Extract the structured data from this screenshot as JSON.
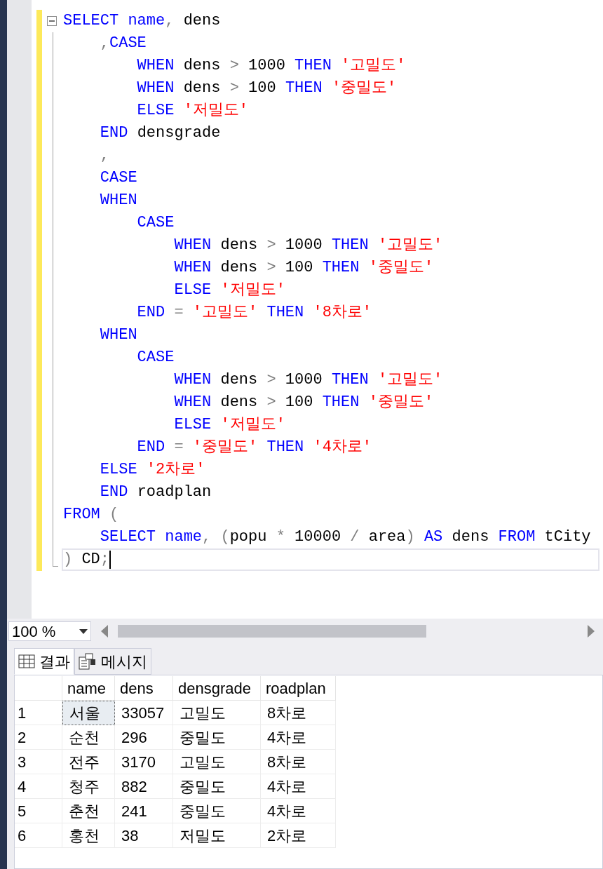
{
  "editor": {
    "lines": [
      {
        "fold_box": true,
        "changed": true,
        "current": false,
        "tokens": [
          {
            "kind": "kw",
            "text": "SELECT "
          },
          {
            "kind": "kw",
            "text": "name"
          },
          {
            "kind": "op",
            "text": ", "
          },
          {
            "kind": "txt",
            "text": "dens"
          }
        ]
      },
      {
        "changed": true,
        "current": false,
        "tokens": [
          {
            "kind": "op",
            "text": "    ,"
          },
          {
            "kind": "kw",
            "text": "CASE"
          }
        ]
      },
      {
        "changed": true,
        "current": false,
        "tokens": [
          {
            "kind": "kw",
            "text": "        WHEN "
          },
          {
            "kind": "txt",
            "text": "dens "
          },
          {
            "kind": "op",
            "text": "> "
          },
          {
            "kind": "txt",
            "text": "1000 "
          },
          {
            "kind": "kw",
            "text": "THEN "
          },
          {
            "kind": "str",
            "text": "'고밀도'"
          }
        ]
      },
      {
        "changed": true,
        "current": false,
        "tokens": [
          {
            "kind": "kw",
            "text": "        WHEN "
          },
          {
            "kind": "txt",
            "text": "dens "
          },
          {
            "kind": "op",
            "text": "> "
          },
          {
            "kind": "txt",
            "text": "100 "
          },
          {
            "kind": "kw",
            "text": "THEN "
          },
          {
            "kind": "str",
            "text": "'중밀도'"
          }
        ]
      },
      {
        "changed": true,
        "current": false,
        "tokens": [
          {
            "kind": "kw",
            "text": "        ELSE "
          },
          {
            "kind": "str",
            "text": "'저밀도'"
          }
        ]
      },
      {
        "changed": true,
        "current": false,
        "tokens": [
          {
            "kind": "kw",
            "text": "    END "
          },
          {
            "kind": "txt",
            "text": "densgrade"
          }
        ]
      },
      {
        "changed": true,
        "current": false,
        "tokens": [
          {
            "kind": "op",
            "text": "    ,"
          }
        ]
      },
      {
        "changed": true,
        "current": false,
        "tokens": [
          {
            "kind": "kw",
            "text": "    CASE"
          }
        ]
      },
      {
        "changed": true,
        "current": false,
        "tokens": [
          {
            "kind": "kw",
            "text": "    WHEN"
          }
        ]
      },
      {
        "changed": true,
        "current": false,
        "tokens": [
          {
            "kind": "kw",
            "text": "        CASE"
          }
        ]
      },
      {
        "changed": true,
        "current": false,
        "tokens": [
          {
            "kind": "kw",
            "text": "            WHEN "
          },
          {
            "kind": "txt",
            "text": "dens "
          },
          {
            "kind": "op",
            "text": "> "
          },
          {
            "kind": "txt",
            "text": "1000 "
          },
          {
            "kind": "kw",
            "text": "THEN "
          },
          {
            "kind": "str",
            "text": "'고밀도'"
          }
        ]
      },
      {
        "changed": true,
        "current": false,
        "tokens": [
          {
            "kind": "kw",
            "text": "            WHEN "
          },
          {
            "kind": "txt",
            "text": "dens "
          },
          {
            "kind": "op",
            "text": "> "
          },
          {
            "kind": "txt",
            "text": "100 "
          },
          {
            "kind": "kw",
            "text": "THEN "
          },
          {
            "kind": "str",
            "text": "'중밀도'"
          }
        ]
      },
      {
        "changed": true,
        "current": false,
        "tokens": [
          {
            "kind": "kw",
            "text": "            ELSE "
          },
          {
            "kind": "str",
            "text": "'저밀도'"
          }
        ]
      },
      {
        "changed": true,
        "current": false,
        "tokens": [
          {
            "kind": "kw",
            "text": "        END "
          },
          {
            "kind": "op",
            "text": "= "
          },
          {
            "kind": "str",
            "text": "'고밀도' "
          },
          {
            "kind": "kw",
            "text": "THEN "
          },
          {
            "kind": "str",
            "text": "'8차로'"
          }
        ]
      },
      {
        "changed": true,
        "current": false,
        "tokens": [
          {
            "kind": "kw",
            "text": "    WHEN"
          }
        ]
      },
      {
        "changed": true,
        "current": false,
        "tokens": [
          {
            "kind": "kw",
            "text": "        CASE"
          }
        ]
      },
      {
        "changed": true,
        "current": false,
        "tokens": [
          {
            "kind": "kw",
            "text": "            WHEN "
          },
          {
            "kind": "txt",
            "text": "dens "
          },
          {
            "kind": "op",
            "text": "> "
          },
          {
            "kind": "txt",
            "text": "1000 "
          },
          {
            "kind": "kw",
            "text": "THEN "
          },
          {
            "kind": "str",
            "text": "'고밀도'"
          }
        ]
      },
      {
        "changed": true,
        "current": false,
        "tokens": [
          {
            "kind": "kw",
            "text": "            WHEN "
          },
          {
            "kind": "txt",
            "text": "dens "
          },
          {
            "kind": "op",
            "text": "> "
          },
          {
            "kind": "txt",
            "text": "100 "
          },
          {
            "kind": "kw",
            "text": "THEN "
          },
          {
            "kind": "str",
            "text": "'중밀도'"
          }
        ]
      },
      {
        "changed": true,
        "current": false,
        "tokens": [
          {
            "kind": "kw",
            "text": "            ELSE "
          },
          {
            "kind": "str",
            "text": "'저밀도'"
          }
        ]
      },
      {
        "changed": true,
        "current": false,
        "tokens": [
          {
            "kind": "kw",
            "text": "        END "
          },
          {
            "kind": "op",
            "text": "= "
          },
          {
            "kind": "str",
            "text": "'중밀도' "
          },
          {
            "kind": "kw",
            "text": "THEN "
          },
          {
            "kind": "str",
            "text": "'4차로'"
          }
        ]
      },
      {
        "changed": true,
        "current": false,
        "tokens": [
          {
            "kind": "kw",
            "text": "    ELSE "
          },
          {
            "kind": "str",
            "text": "'2차로'"
          }
        ]
      },
      {
        "changed": true,
        "current": false,
        "tokens": [
          {
            "kind": "kw",
            "text": "    END "
          },
          {
            "kind": "txt",
            "text": "roadplan"
          }
        ]
      },
      {
        "changed": true,
        "current": false,
        "tokens": [
          {
            "kind": "kw",
            "text": "FROM "
          },
          {
            "kind": "op",
            "text": "("
          }
        ]
      },
      {
        "changed": true,
        "current": false,
        "tokens": [
          {
            "kind": "kw",
            "text": "    SELECT "
          },
          {
            "kind": "kw",
            "text": "name"
          },
          {
            "kind": "op",
            "text": ", ("
          },
          {
            "kind": "txt",
            "text": "popu "
          },
          {
            "kind": "op",
            "text": "* "
          },
          {
            "kind": "txt",
            "text": "10000 "
          },
          {
            "kind": "op",
            "text": "/ "
          },
          {
            "kind": "txt",
            "text": "area"
          },
          {
            "kind": "op",
            "text": ") "
          },
          {
            "kind": "kw",
            "text": "AS "
          },
          {
            "kind": "txt",
            "text": "dens "
          },
          {
            "kind": "kw",
            "text": "FROM "
          },
          {
            "kind": "txt",
            "text": "tCity"
          }
        ]
      },
      {
        "fold_end": true,
        "changed": true,
        "current": true,
        "tokens": [
          {
            "kind": "op",
            "text": ") "
          },
          {
            "kind": "txt",
            "text": "CD"
          },
          {
            "kind": "op",
            "text": ";"
          }
        ]
      }
    ]
  },
  "zoom": {
    "value": "100 %"
  },
  "result_tabs": [
    {
      "kind": "grid",
      "label": "결과",
      "selected": true
    },
    {
      "kind": "messages",
      "label": "메시지",
      "selected": false
    }
  ],
  "results": {
    "columns": [
      "name",
      "dens",
      "densgrade",
      "roadplan"
    ],
    "rows": [
      {
        "number": "1",
        "cells": [
          {
            "text": "서울",
            "selected": true
          },
          {
            "text": "33057",
            "selected": false
          },
          {
            "text": "고밀도",
            "selected": false
          },
          {
            "text": "8차로",
            "selected": false
          }
        ]
      },
      {
        "number": "2",
        "cells": [
          {
            "text": "순천",
            "selected": false
          },
          {
            "text": "296",
            "selected": false
          },
          {
            "text": "중밀도",
            "selected": false
          },
          {
            "text": "4차로",
            "selected": false
          }
        ]
      },
      {
        "number": "3",
        "cells": [
          {
            "text": "전주",
            "selected": false
          },
          {
            "text": "3170",
            "selected": false
          },
          {
            "text": "고밀도",
            "selected": false
          },
          {
            "text": "8차로",
            "selected": false
          }
        ]
      },
      {
        "number": "4",
        "cells": [
          {
            "text": "청주",
            "selected": false
          },
          {
            "text": "882",
            "selected": false
          },
          {
            "text": "중밀도",
            "selected": false
          },
          {
            "text": "4차로",
            "selected": false
          }
        ]
      },
      {
        "number": "5",
        "cells": [
          {
            "text": "춘천",
            "selected": false
          },
          {
            "text": "241",
            "selected": false
          },
          {
            "text": "중밀도",
            "selected": false
          },
          {
            "text": "4차로",
            "selected": false
          }
        ]
      },
      {
        "number": "6",
        "cells": [
          {
            "text": "홍천",
            "selected": false
          },
          {
            "text": "38",
            "selected": false
          },
          {
            "text": "저밀도",
            "selected": false
          },
          {
            "text": "2차로",
            "selected": false
          }
        ]
      }
    ]
  }
}
